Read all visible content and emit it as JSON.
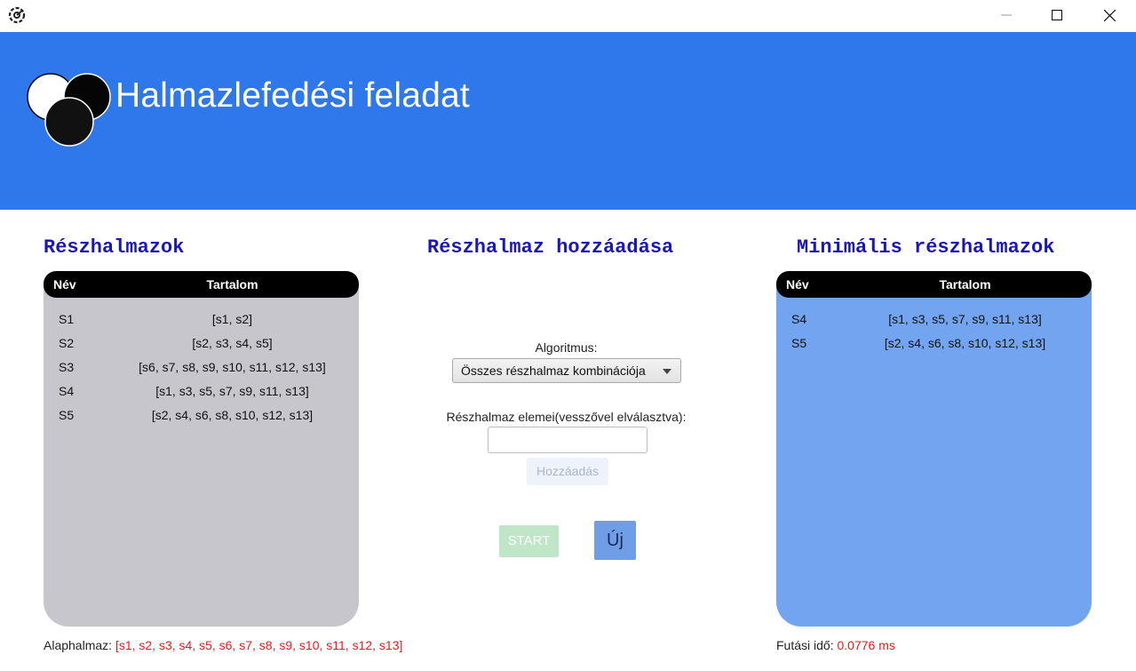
{
  "window": {
    "controls": {
      "minimize": "minimize",
      "maximize": "maximize",
      "close": "close"
    }
  },
  "header": {
    "title": "Halmazlefedési feladat",
    "background_color": "#2f78eb"
  },
  "left_panel": {
    "title": "Részhalmazok",
    "columns": {
      "name": "Név",
      "content": "Tartalom"
    },
    "rows": [
      {
        "name": "S1",
        "content": "[s1, s2]"
      },
      {
        "name": "S2",
        "content": "[s2, s3, s4, s5]"
      },
      {
        "name": "S3",
        "content": "[s6, s7, s8, s9, s10, s11, s12, s13]"
      },
      {
        "name": "S4",
        "content": "[s1, s3, s5, s7, s9, s11, s13]"
      },
      {
        "name": "S5",
        "content": "[s2, s4, s6, s8, s10, s12, s13]"
      }
    ]
  },
  "center": {
    "title": "Részhalmaz hozzáadása",
    "algorithm_label": "Algoritmus:",
    "algorithm_selected": "Összes részhalmaz kombinációja",
    "elements_label": "Részhalmaz elemei(vesszővel elválasztva):",
    "elements_value": "",
    "add_button": "Hozzáadás",
    "start_button": "START",
    "new_button": "Új"
  },
  "right_panel": {
    "title": "Minimális részhalmazok",
    "columns": {
      "name": "Név",
      "content": "Tartalom"
    },
    "rows": [
      {
        "name": "S4",
        "content": "[s1, s3, s5, s7, s9, s11, s13]"
      },
      {
        "name": "S5",
        "content": "[s2, s4, s6, s8, s10, s12, s13]"
      }
    ]
  },
  "footer": {
    "base_set_label": "Alaphalmaz:",
    "base_set_value": "[s1, s2, s3, s4, s5, s6, s7, s8, s9, s10, s11, s12, s13]",
    "runtime_label": "Futási idő:",
    "runtime_value": "0.0776 ms"
  },
  "colors": {
    "accent": "#2f78eb",
    "section_title": "#1a17b5",
    "left_panel_bg": "#c6c6cc",
    "right_panel_bg": "#73a4ef",
    "highlight_text": "#e8191c"
  },
  "icons": {
    "app": "gear-speed-icon",
    "logo": "overlapping-circles-logo"
  }
}
